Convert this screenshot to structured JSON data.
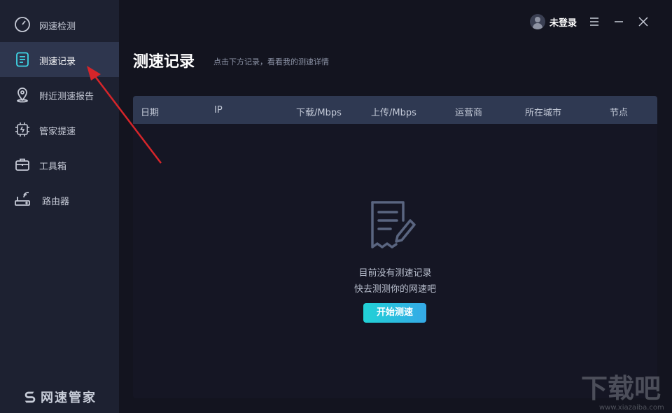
{
  "sidebar": {
    "items": [
      {
        "label": "网速检测",
        "icon": "speedometer-icon"
      },
      {
        "label": "测速记录",
        "icon": "record-list-icon",
        "active": true
      },
      {
        "label": "附近测速报告",
        "icon": "location-pin-icon"
      },
      {
        "label": "管家提速",
        "icon": "chip-icon"
      },
      {
        "label": "工具箱",
        "icon": "toolbox-icon"
      },
      {
        "label": "路由器",
        "icon": "router-icon"
      }
    ],
    "brand": "网速管家"
  },
  "header": {
    "user_name": "未登录",
    "menu_icon": "hamburger-icon",
    "minimize_icon": "minimize-icon",
    "close_icon": "close-icon"
  },
  "page": {
    "title": "测速记录",
    "subtitle": "点击下方记录，看看我的测速详情"
  },
  "table": {
    "columns": [
      "日期",
      "IP",
      "下载/Mbps",
      "上传/Mbps",
      "运营商",
      "所在城市",
      "节点"
    ]
  },
  "empty_state": {
    "icon": "empty-document-icon",
    "line1": "目前没有测速记录",
    "line2": "快去测测你的网速吧",
    "button": "开始测速"
  },
  "watermark": {
    "text": "下载吧",
    "url_text": "www.xiazaiba.com"
  },
  "colors": {
    "sidebar_bg": "#1d2131",
    "active_item_bg": "#2e364e",
    "main_bg": "#13141f",
    "table_header_bg": "#2f3952",
    "accent_start": "#21d2d6",
    "accent_end": "#35a9e7",
    "annotation_arrow": "#d6252a"
  }
}
